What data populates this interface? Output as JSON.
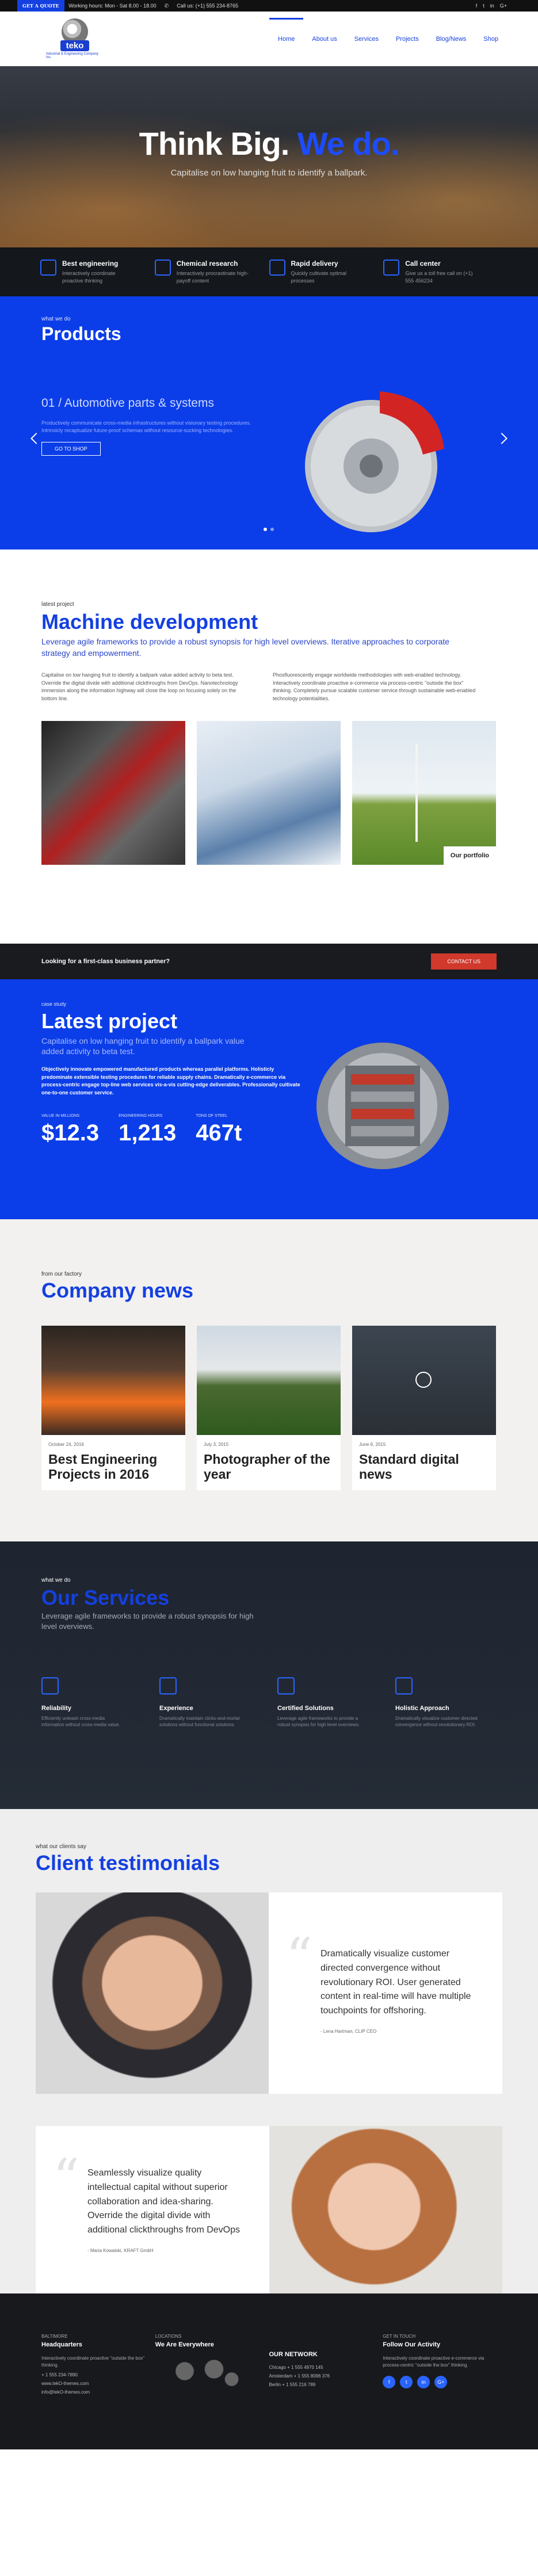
{
  "topbar": {
    "hours": "Working hours: Mon - Sat 8.00 - 18.00",
    "call": "Call us: (+1) 555 234-8765",
    "quote_btn": "GET A QUOTE"
  },
  "logo": {
    "word": "teko",
    "tagline": "Industrial & Engineering Company Inc."
  },
  "nav": [
    "Home",
    "About us",
    "Services",
    "Projects",
    "Blog/News",
    "Shop"
  ],
  "hero": {
    "title_a": "Think Big.",
    "title_b": "We do.",
    "subtitle": "Capitalise on low hanging fruit to identify a ballpark."
  },
  "features": [
    {
      "title": "Best engineering",
      "text": "Interactively coordinate proactive thinking"
    },
    {
      "title": "Chemical research",
      "text": "Interactively procrastinate high-payoff content"
    },
    {
      "title": "Rapid delivery",
      "text": "Quickly cultivate optimal processes"
    },
    {
      "title": "Call center",
      "text": "Give us a toll free call on (+1) 555 456234"
    }
  ],
  "products": {
    "kicker": "what we do",
    "title": "Products",
    "slide": "01 / Automotive parts & systems",
    "desc": "Productively communicate cross-media infrastructures without visionary testing procedures. Intrinsicly recaptualize future-proof schemas without resource-sucking technologies.",
    "btn": "GO TO SHOP"
  },
  "machine": {
    "kicker": "latest project",
    "title": "Machine development",
    "lead": "Leverage agile frameworks to provide a robust synopsis for high level overviews. Iterative approaches to corporate strategy and empowerment.",
    "col1": "Capitalise on low hanging fruit to identify a ballpark value added activity to beta test. Override the digital divide with additional clickthroughs from DevOps. Nanotechnology immersion along the information highway will close the loop on focusing solely on the bottom line.",
    "col2": "Phosfluorescently engage worldwide methodologies with web-enabled technology. Interactively coordinate proactive e-commerce via process-centric \"outside the box\" thinking. Completely pursue scalable customer service through sustainable web-enabled technology potentialities.",
    "portfolio": "Our portfolio"
  },
  "partner": {
    "text": "Looking for a first-class business partner?",
    "btn": "CONTACT US"
  },
  "latest": {
    "kicker": "case study",
    "title": "Latest project",
    "lead": "Capitalise on low hanging fruit to identify a ballpark value added activity to beta test.",
    "desc": "Objectively innovate empowered manufactured products whereas parallel platforms. Holisticly predominate extensible testing procedures for reliable supply chains. Dramatically e-commerce via process-centric engage top-line web services vis-a-vis cutting-edge deliverables. Professionally cultivate one-to-one customer service.",
    "stats": [
      {
        "label": "VALUE IN MILLIONS",
        "value": "$12.3"
      },
      {
        "label": "ENGINEERING HOURS",
        "value": "1,213"
      },
      {
        "label": "TONS OF STEEL",
        "value": "467t"
      }
    ]
  },
  "news": {
    "kicker": "from our factory",
    "title": "Company news",
    "items": [
      {
        "date": "October 24, 2016",
        "title": "Best Engineering Projects in 2016"
      },
      {
        "date": "July 3, 2015",
        "title": "Photographer of the year"
      },
      {
        "date": "June 6, 2015",
        "title": "Standard digital news"
      }
    ]
  },
  "services": {
    "kicker": "what we do",
    "title": "Our Services",
    "lead": "Leverage agile frameworks to provide a robust synopsis for high level overviews.",
    "items": [
      {
        "title": "Reliability",
        "text": "Efficiently unleash cross-media information without cross-media value."
      },
      {
        "title": "Experience",
        "text": "Dramatically maintain clicks-and-mortar solutions without functional solutions."
      },
      {
        "title": "Certified Solutions",
        "text": "Leverage agile frameworks to provide a robust synopsis for high level overviews."
      },
      {
        "title": "Holistic Approach",
        "text": "Dramatically visualize customer directed convergence without revolutionary ROI."
      }
    ]
  },
  "testimonials": {
    "kicker": "what our clients say",
    "title": "Client testimonials",
    "items": [
      {
        "text": "Dramatically visualize customer directed convergence without revolutionary ROI. User generated content in real-time will have multiple touchpoints for offshoring.",
        "by": "- Lena Hartman, CLIP CEO"
      },
      {
        "text": "Seamlessly visualize quality intellectual capital without superior collaboration and idea-sharing. Override the digital divide with additional clickthroughs from DevOps",
        "by": "- Maria Kowalski, KRAFT GmbH"
      }
    ]
  },
  "footer": {
    "hq_kicker": "BALTIMORE",
    "hq_title": "Headquarters",
    "hq_text": "Interactively coordinate proactive \"outside the box\" thinking.",
    "phone": "+ 1 555 234-7890",
    "web": "www.tekO-themes.com",
    "email": "info@tekO-themes.com",
    "loc_kicker": "LOCATIONS",
    "loc_title": "We Are Everywhere",
    "net_title": "OUR NETWORK",
    "net": [
      "Chicago + 1 555 4970 145",
      "Amsterdam + 1 555 8096 376",
      "Berlin + 1 555 216 789"
    ],
    "touch_kicker": "GET IN TOUCH",
    "touch_title": "Follow Our Activity",
    "touch_text": "Interactively coordinate proactive e-commerce via process-centric \"outside the box\" thinking."
  }
}
